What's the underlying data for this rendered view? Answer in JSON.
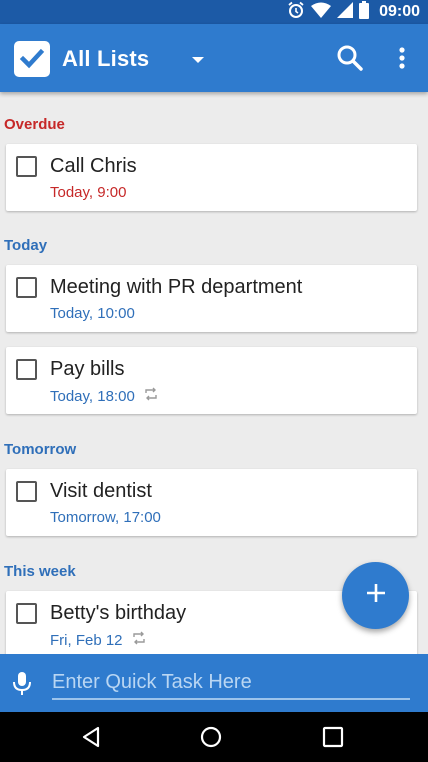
{
  "status_bar": {
    "time": "09:00",
    "icons": [
      "alarm-icon",
      "wifi-icon",
      "signal-icon",
      "battery-icon"
    ]
  },
  "app_bar": {
    "title": "All Lists",
    "icons": [
      "app-logo-check-icon",
      "dropdown-arrow-icon",
      "search-icon",
      "more-vert-icon"
    ]
  },
  "sections": {
    "overdue": {
      "label": "Overdue",
      "tasks": [
        {
          "title": "Call Chris",
          "due": "Today, 9:00",
          "repeat": false
        }
      ]
    },
    "today": {
      "label": "Today",
      "tasks": [
        {
          "title": "Meeting with PR department",
          "due": "Today, 10:00",
          "repeat": false
        },
        {
          "title": "Pay bills",
          "due": "Today, 18:00",
          "repeat": true
        }
      ]
    },
    "tomorrow": {
      "label": "Tomorrow",
      "tasks": [
        {
          "title": "Visit dentist",
          "due": "Tomorrow, 17:00",
          "repeat": false
        }
      ]
    },
    "this_week": {
      "label": "This week",
      "tasks": [
        {
          "title": "Betty's birthday",
          "due": "Fri, Feb 12",
          "repeat": true
        }
      ]
    }
  },
  "fab": {
    "icon": "plus-icon"
  },
  "quick_task": {
    "placeholder": "Enter Quick Task Here",
    "value": "",
    "icon": "mic-icon"
  },
  "nav_bar": {
    "icons": [
      "back-icon",
      "home-icon",
      "recents-icon"
    ]
  },
  "colors": {
    "primary": "#2f7bce",
    "status_bar": "#1c5aa6",
    "overdue": "#c62828",
    "accent_text": "#2f6fb9",
    "background": "#ececec"
  }
}
